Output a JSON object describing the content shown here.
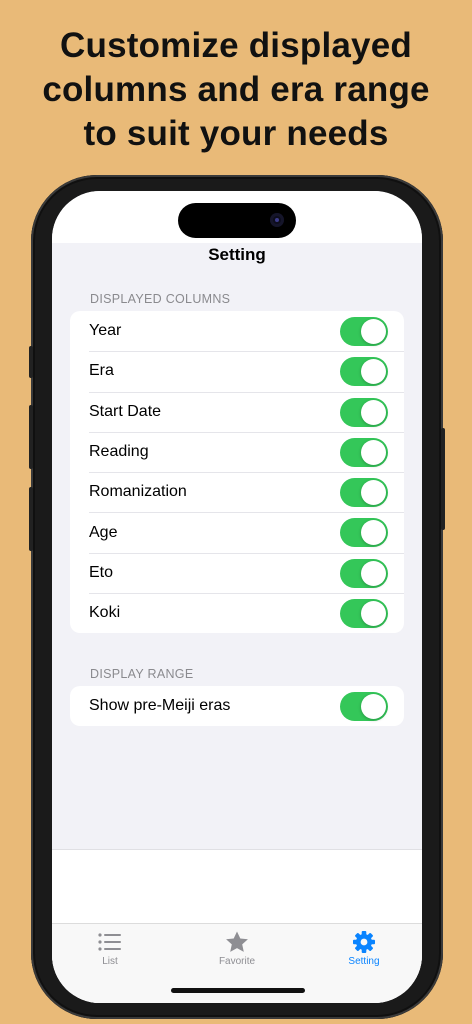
{
  "headline": {
    "line1": "Customize displayed",
    "line2": "columns and era range",
    "line3": "to suit your needs"
  },
  "nav": {
    "title": "Setting"
  },
  "sections": {
    "columns": {
      "header": "DISPLAYED COLUMNS",
      "rows": [
        {
          "label": "Year",
          "on": true
        },
        {
          "label": "Era",
          "on": true
        },
        {
          "label": "Start Date",
          "on": true
        },
        {
          "label": "Reading",
          "on": true
        },
        {
          "label": "Romanization",
          "on": true
        },
        {
          "label": "Age",
          "on": true
        },
        {
          "label": "Eto",
          "on": true
        },
        {
          "label": "Koki",
          "on": true
        }
      ]
    },
    "range": {
      "header": "DISPLAY RANGE",
      "rows": [
        {
          "label": "Show pre-Meiji eras",
          "on": true
        }
      ]
    }
  },
  "tabs": [
    {
      "label": "List",
      "icon": "list-icon",
      "active": false
    },
    {
      "label": "Favorite",
      "icon": "star-icon",
      "active": false
    },
    {
      "label": "Setting",
      "icon": "gear-icon",
      "active": true
    }
  ],
  "colors": {
    "background": "#E9BA78",
    "toggle_on": "#34C759",
    "accent": "#0A84FF"
  }
}
